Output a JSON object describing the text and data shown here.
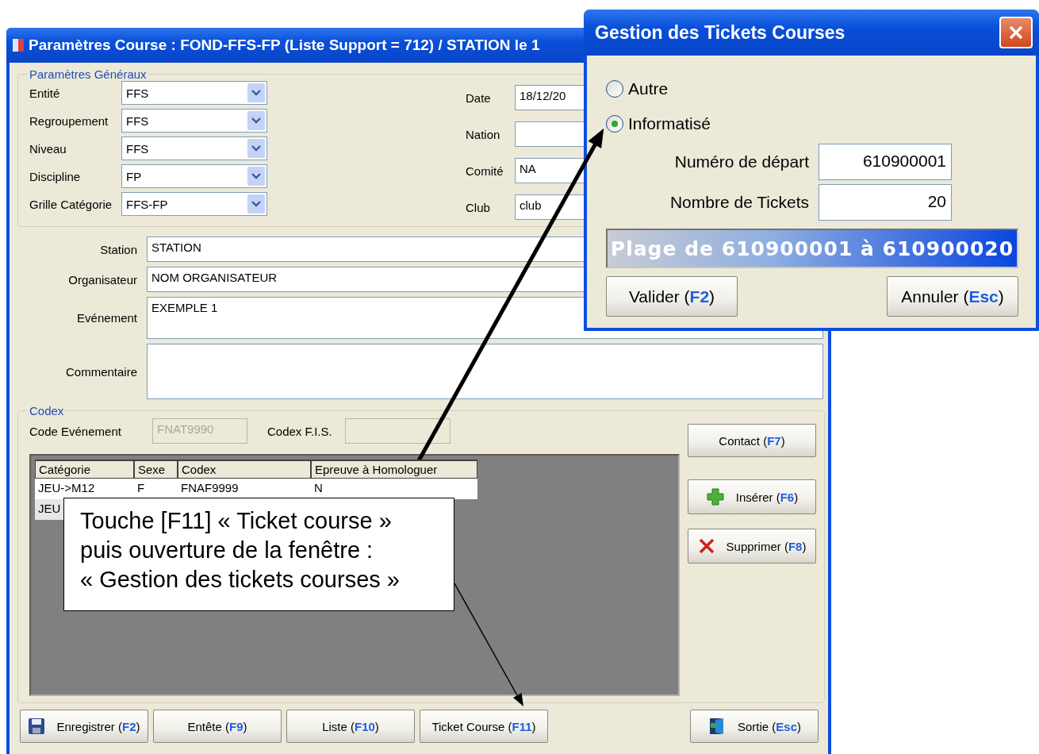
{
  "main_window": {
    "title": "Paramètres Course : FOND-FFS-FP (Liste Support = 712) / STATION le 1",
    "general": {
      "legend": "Paramètres Généraux",
      "combos": [
        {
          "label": "Entité",
          "value": "FFS"
        },
        {
          "label": "Regroupement",
          "value": "FFS"
        },
        {
          "label": "Niveau",
          "value": "FFS"
        },
        {
          "label": "Discipline",
          "value": "FP"
        },
        {
          "label": "Grille Catégorie",
          "value": "FFS-FP"
        }
      ],
      "side_fields": [
        {
          "label": "Date",
          "value": "18/12/20"
        },
        {
          "label": "Nation"
        },
        {
          "label": "Comité",
          "value": "NA"
        },
        {
          "label": "Club",
          "value": "club"
        }
      ]
    },
    "text_fields": [
      {
        "label": "Station",
        "value": "STATION",
        "kind": "single"
      },
      {
        "label": "Organisateur",
        "value": "NOM ORGANISATEUR",
        "kind": "single"
      },
      {
        "label": "Evénement",
        "value": "EXEMPLE 1",
        "kind": "multi"
      },
      {
        "label": "Commentaire",
        "kind": "tall"
      }
    ],
    "codex": {
      "legend": "Codex",
      "code_label": "Code Evénement",
      "code_value": "FNAT9990",
      "fis_label": "Codex F.I.S.",
      "table": {
        "columns": [
          "Catégorie",
          "Sexe",
          "Codex",
          "Epreuve à Homologuer"
        ],
        "rows": [
          [
            "JEU->M12",
            "F",
            "FNAF9999",
            "N"
          ],
          [
            "JEU"
          ]
        ]
      },
      "side_buttons": [
        {
          "label": "Contact (**F7**)",
          "kind": "plain"
        },
        {
          "label": "Insérer (**F6**)",
          "kind": "insert"
        },
        {
          "label": "Supprimer (**F8**)",
          "kind": "delete"
        }
      ]
    },
    "bottom_buttons": [
      {
        "label": "Enregistrer (**F2**)",
        "kind": "save"
      },
      {
        "label": "Entête (**F9**)",
        "kind": "plain"
      },
      {
        "label": "Liste (**F10**)",
        "kind": "plain"
      },
      {
        "label": "Ticket Course (**F11**)",
        "kind": "plain"
      },
      {
        "label": "Sortie (**Esc**)",
        "kind": "exit"
      }
    ]
  },
  "dialog": {
    "title": "Gestion des Tickets Courses",
    "radios": [
      {
        "label": "Autre",
        "selected": false
      },
      {
        "label": "Informatisé",
        "selected": true
      }
    ],
    "fields": [
      {
        "label": "Numéro de départ",
        "value": "610900001"
      },
      {
        "label": "Nombre de Tickets",
        "value": "20"
      }
    ],
    "range": "Plage de 610900001 à 610900020",
    "buttons": [
      "Valider (**F2**)",
      "Annuler (**Esc**)"
    ]
  },
  "callout": {
    "lines": [
      "Touche [F11] « Ticket course »",
      "puis ouverture de la fenêtre :",
      "« Gestion des tickets courses »"
    ]
  }
}
